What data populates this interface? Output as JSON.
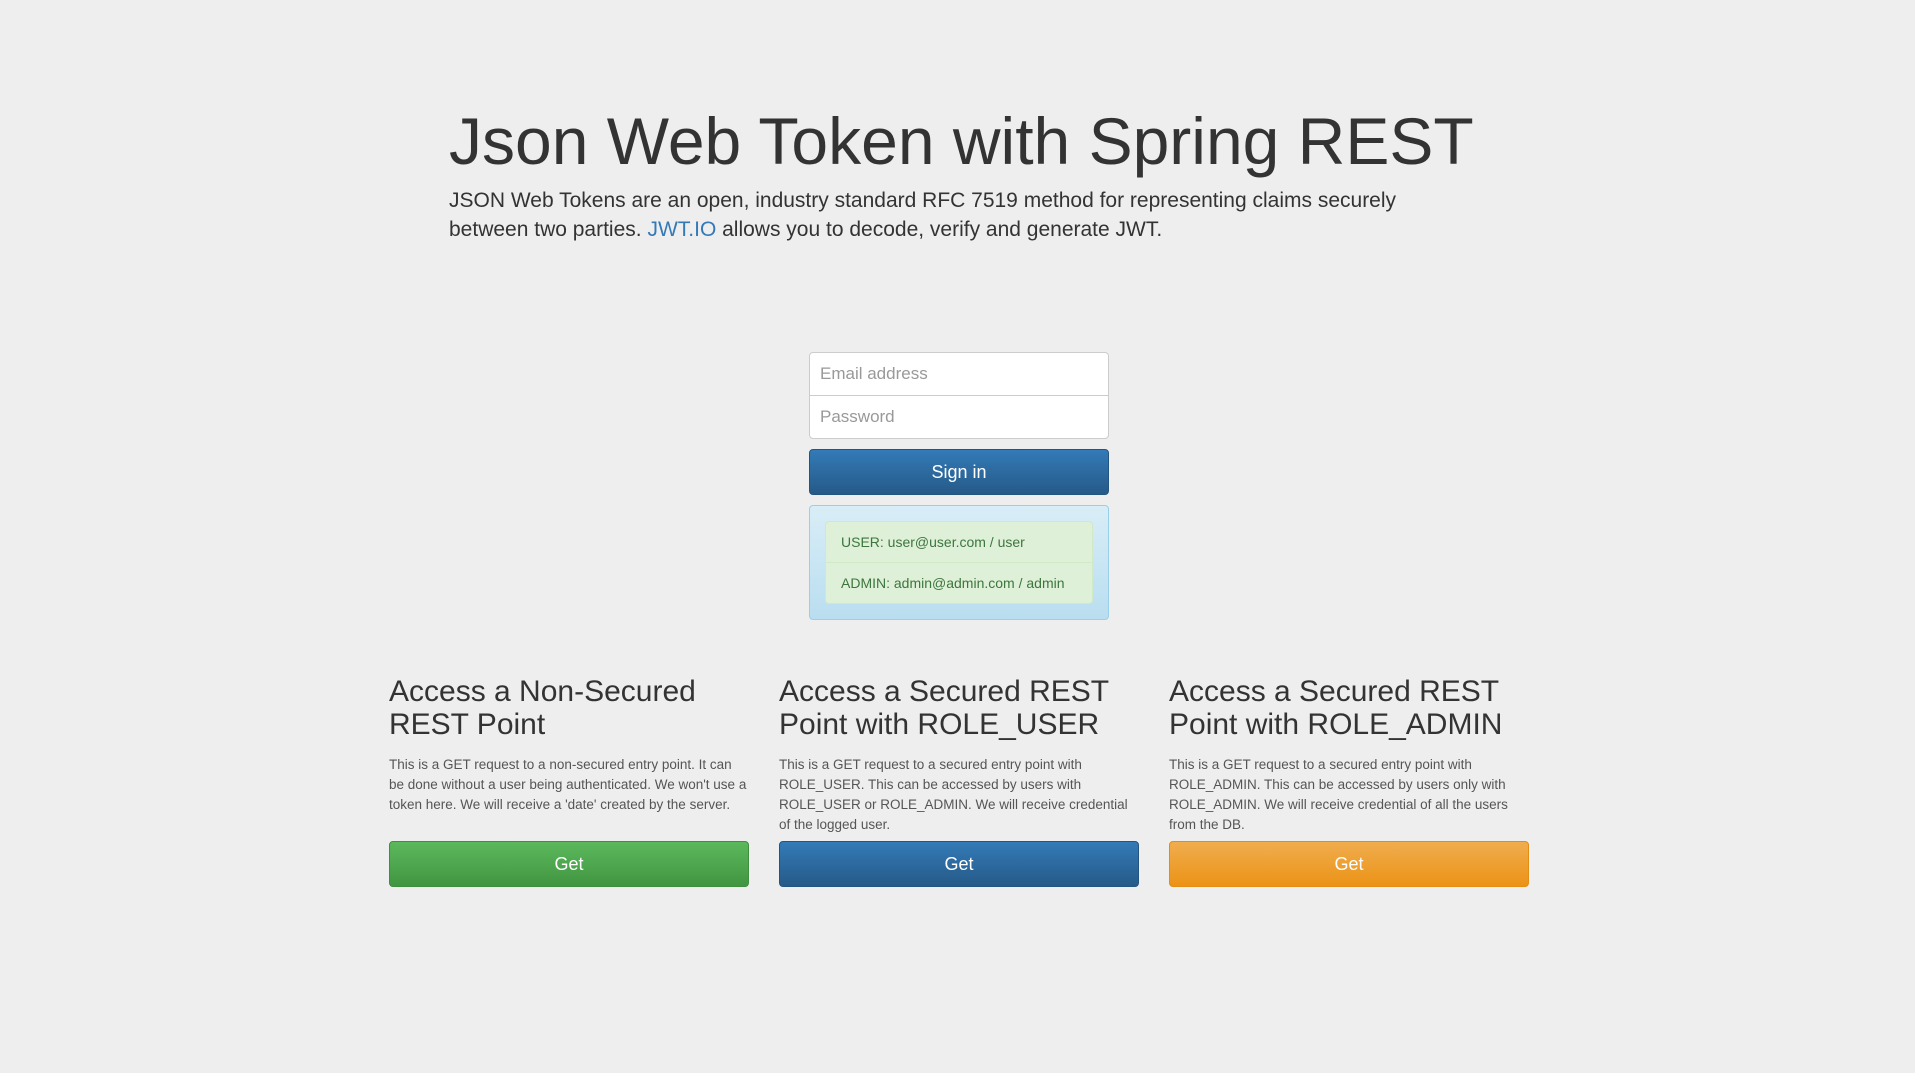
{
  "hero": {
    "title": "Json Web Token with Spring REST",
    "intro_before_link": "JSON Web Tokens are an open, industry standard RFC 7519 method for representing claims securely between two parties. ",
    "link_text": "JWT.IO",
    "intro_after_link": " allows you to decode, verify and generate JWT."
  },
  "login": {
    "email_placeholder": "Email address",
    "password_placeholder": "Password",
    "signin_label": "Sign in",
    "credentials": [
      "USER: user@user.com / user",
      "ADMIN: admin@admin.com / admin"
    ]
  },
  "columns": [
    {
      "heading": "Access a Non-Secured REST Point",
      "description": "This is a GET request to a non-secured entry point. It can be done without a user being authenticated. We won't use a token here. We will receive a 'date' created by the server.",
      "button_label": "Get",
      "button_color": "#5cb85c"
    },
    {
      "heading": "Access a Secured REST Point with ROLE_USER",
      "description": "This is a GET request to a secured entry point with ROLE_USER. This can be accessed by users with ROLE_USER or ROLE_ADMIN. We will receive credential of the logged user.",
      "button_label": "Get",
      "button_color": "#337ab7"
    },
    {
      "heading": "Access a Secured REST Point with ROLE_ADMIN",
      "description": "This is a GET request to a secured entry point with ROLE_ADMIN. This can be accessed by users only with ROLE_ADMIN. We will receive credential of all the users from the DB.",
      "button_label": "Get",
      "button_color": "#f0ad4e"
    }
  ],
  "colors": {
    "background": "#eeeeee",
    "link": "#337ab7",
    "primary": "#337ab7",
    "success": "#5cb85c",
    "warning": "#f0ad4e",
    "info_panel": "#d9edf7",
    "success_panel": "#dff0d8"
  }
}
